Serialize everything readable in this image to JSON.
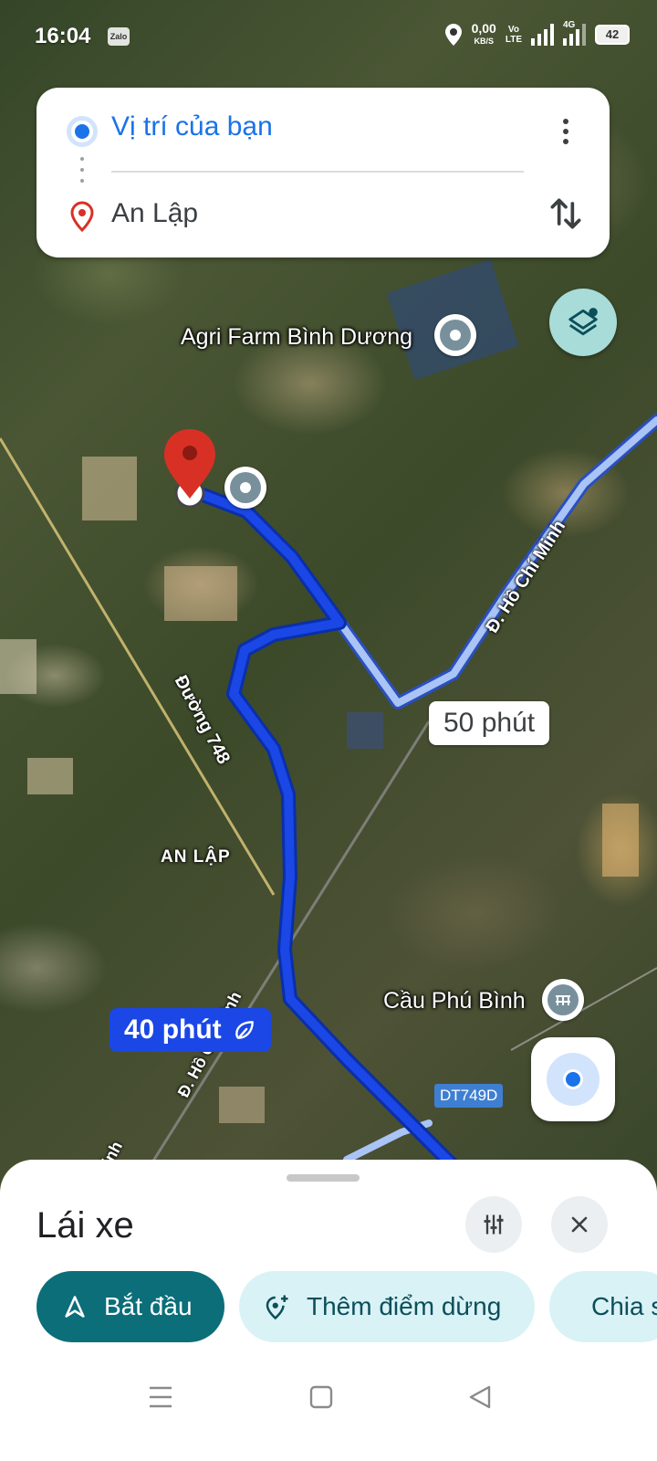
{
  "status_bar": {
    "time": "16:04",
    "zalo_badge": "Zalo",
    "speed_value": "0,00",
    "speed_unit": "KB/S",
    "volte_top": "Vo",
    "volte_bottom": "LTE",
    "network_type": "4G",
    "battery": "42"
  },
  "directions": {
    "origin": "Vị trí của bạn",
    "destination": "An Lập",
    "more_icon": "more-vert-icon",
    "swap_icon": "swap-vert-icon"
  },
  "map": {
    "labels": {
      "agri_farm": "Agri Farm Bình Dương",
      "an_lap": "AN LẬP",
      "cau_phu_binh": "Cầu Phú Bình",
      "road_748": "Đường 748",
      "road_hcm_upper": "Đ. Hồ Chí Minh",
      "road_hcm_lower": "Đ. Hồ Chí Minh",
      "road_hcm_bottom": "Minh",
      "route_badge": "DT749D"
    },
    "alt_route_time": "50 phút",
    "main_route_time": "40 phút",
    "colors": {
      "main_route": "#1a47e6",
      "alt_route": "#a9c4f5",
      "accent": "#1a73e8"
    }
  },
  "sheet": {
    "title": "Lái xe",
    "start_label": "Bắt đầu",
    "add_stop_label": "Thêm điểm dừng",
    "share_label": "Chia sẻ"
  }
}
